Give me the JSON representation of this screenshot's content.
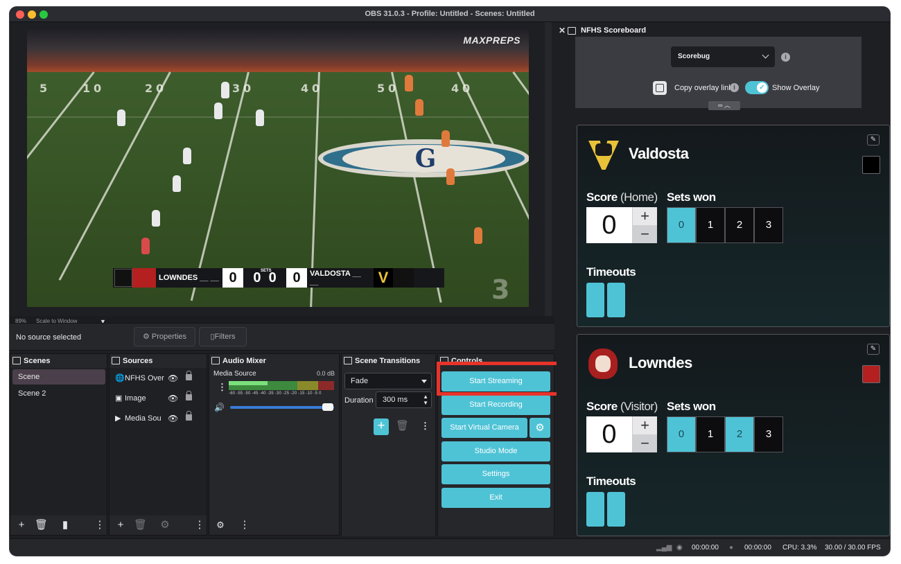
{
  "window": {
    "title": "OBS 31.0.3 - Profile: Untitled - Scenes: Untitled"
  },
  "preview": {
    "watermark": "MAXPREPS",
    "scorebug": {
      "home_team": "LOWNDES",
      "home_score": "0",
      "home_dashes": "__ __",
      "sets_home": "0",
      "sets_label": "SETS",
      "sets_away": "0",
      "away_score": "0",
      "away_team": "VALDOSTA",
      "away_dashes": "__ __",
      "away_logo_letter": "V"
    },
    "yard_numbers": [
      "5",
      "1",
      "0",
      "2",
      "0",
      "3",
      "0",
      "4",
      "0",
      "5",
      "0",
      "4",
      "0",
      "3"
    ],
    "center_logo_letter": "G"
  },
  "scale": {
    "zoom": "89%",
    "mode": "Scale to Window"
  },
  "source_toolbar": {
    "status": "No source selected",
    "properties_label": "Properties",
    "filters_label": "Filters"
  },
  "scenes": {
    "title": "Scenes",
    "items": [
      {
        "label": "Scene",
        "active": true
      },
      {
        "label": "Scene 2",
        "active": false
      }
    ]
  },
  "sources": {
    "title": "Sources",
    "items": [
      {
        "label": "NFHS Over",
        "icon": "globe-icon"
      },
      {
        "label": "Image",
        "icon": "image-icon"
      },
      {
        "label": "Media Sou",
        "icon": "play-icon"
      }
    ]
  },
  "audio_mixer": {
    "title": "Audio Mixer",
    "channel": "Media Source",
    "level": "0.0 dB",
    "scale": "-60 -55 -50 -45 -40 -35 -30 -25 -20 -15 -10 -5  0"
  },
  "transitions": {
    "title": "Scene Transitions",
    "selected": "Fade",
    "duration_label": "Duration",
    "duration_value": "300 ms"
  },
  "controls": {
    "title": "Controls",
    "start_streaming": "Start Streaming",
    "start_recording": "Start Recording",
    "start_virtual_camera": "Start Virtual Camera",
    "studio_mode": "Studio Mode",
    "settings": "Settings",
    "exit": "Exit"
  },
  "statusbar": {
    "stream_time": "00:00:00",
    "record_time": "00:00:00",
    "cpu": "CPU: 3.3%",
    "fps": "30.00 / 30.00 FPS"
  },
  "scoreboard": {
    "title": "NFHS Scoreboard",
    "overlay_select": "Scorebug",
    "copy_link_label": "Copy overlay link",
    "show_overlay_label": "Show Overlay",
    "show_overlay_on": true,
    "score_label": "Score",
    "sets_won_label": "Sets won",
    "timeouts_label": "Timeouts",
    "plus": "+",
    "minus": "−",
    "set_options": [
      "0",
      "1",
      "2",
      "3"
    ],
    "home": {
      "name": "Valdosta",
      "side": "(Home)",
      "score": "0",
      "sets_selected": "0",
      "color": "#000000",
      "timeouts": 2
    },
    "visitor": {
      "name": "Lowndes",
      "side": "(Visitor)",
      "score": "0",
      "sets_selected_highlight": [
        "0",
        "2"
      ],
      "color": "#b3201f",
      "timeouts": 2
    }
  },
  "accent_color": "#4fc3d6",
  "highlight_color": "#e8332a"
}
